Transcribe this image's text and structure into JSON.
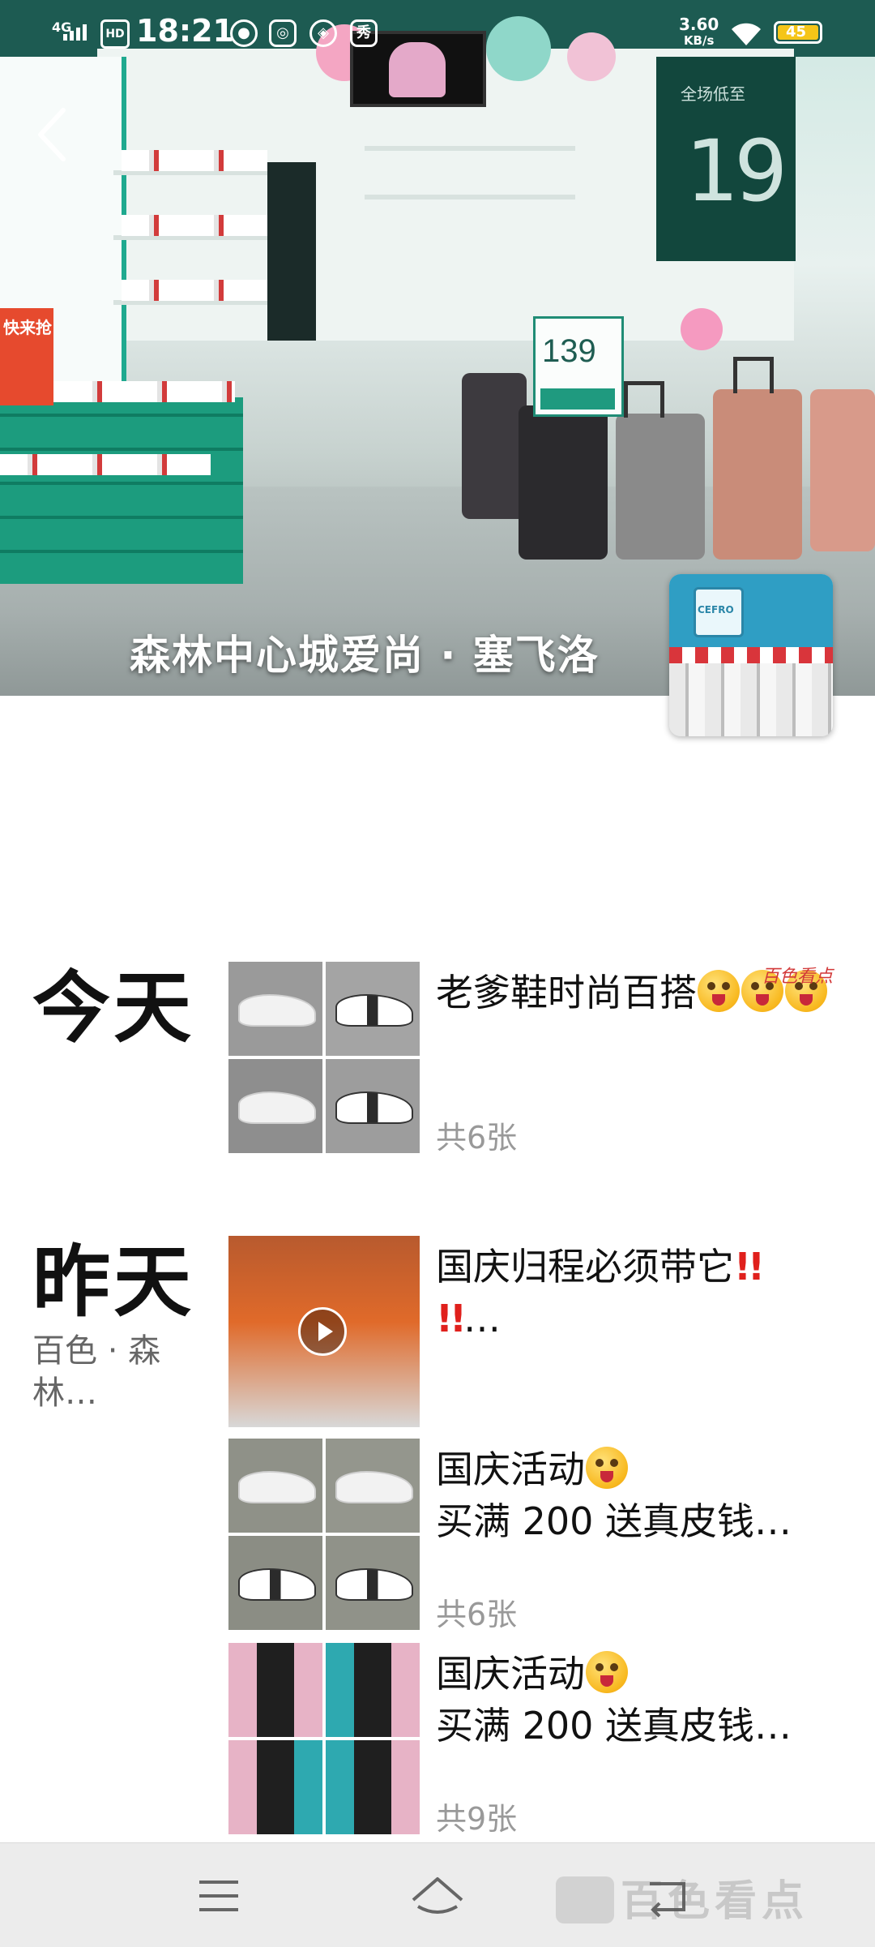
{
  "status_bar": {
    "time": "18:21",
    "network": "4G",
    "hd": "HD",
    "app_badge": "秀",
    "speed_value": "3.60",
    "speed_unit": "KB/s",
    "battery": "45"
  },
  "header": {
    "store_name": "森林中心城爱尚 · 塞飞洛"
  },
  "cover_signage": {
    "promo_text": "全场低至",
    "promo_price": "19",
    "price_tag": "139",
    "sale_sign": "快来抢"
  },
  "avatar": {
    "brand_text": "CEFRO"
  },
  "feed": {
    "today": {
      "label": "今天",
      "post": {
        "title": "老爹鞋时尚百搭",
        "count": "共6张"
      }
    },
    "yesterday": {
      "label": "昨天",
      "location": "百色 · 森林…",
      "posts": [
        {
          "title": "国庆归程必须带它",
          "suffix": "…"
        },
        {
          "line1": "国庆活动",
          "line2": "买满 200 送真皮钱…",
          "count": "共6张"
        },
        {
          "line1": "国庆活动",
          "line2": "买满 200 送真皮钱…",
          "count": "共9张"
        }
      ]
    }
  },
  "watermark": {
    "corner": "百色看点",
    "bottom": "百色看点"
  },
  "colors": {
    "teal": "#1fa98f",
    "accent_red": "#e0201c",
    "nav_bg": "#ececec"
  }
}
